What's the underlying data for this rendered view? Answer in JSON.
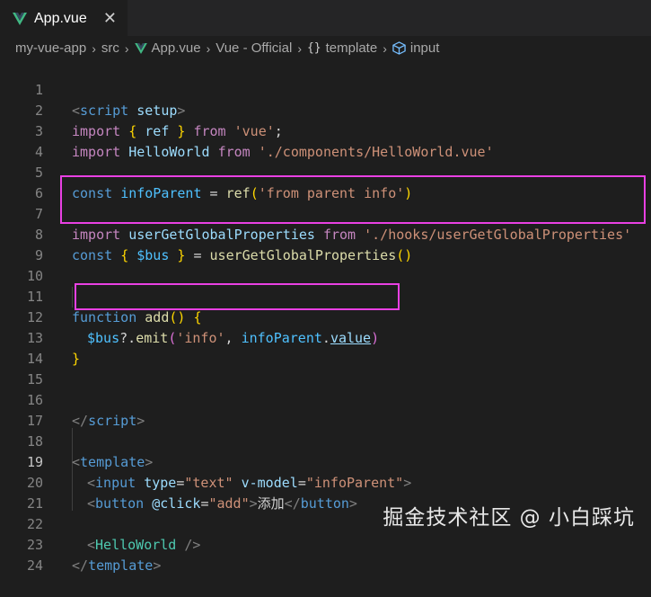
{
  "tab": {
    "title": "App.vue",
    "close": "✕"
  },
  "breadcrumb": {
    "items": [
      "my-vue-app",
      "src",
      "App.vue",
      "Vue - Official",
      "template",
      "input"
    ],
    "sep": "›"
  },
  "editor": {
    "active_line": 19,
    "line_numbers": [
      "1",
      "2",
      "3",
      "4",
      "5",
      "6",
      "7",
      "8",
      "9",
      "10",
      "11",
      "12",
      "13",
      "14",
      "15",
      "16",
      "17",
      "18",
      "19",
      "20",
      "21",
      "22",
      "23",
      "24"
    ],
    "lines": {
      "l1": [
        "<",
        "script",
        " ",
        "setup",
        ">"
      ],
      "l2": [
        "import",
        " ",
        "{",
        " ",
        "ref",
        " ",
        "}",
        " ",
        "from",
        " ",
        "'vue'",
        ";"
      ],
      "l3": [
        "import",
        " ",
        "HelloWorld",
        " ",
        "from",
        " ",
        "'./components/HelloWorld.vue'"
      ],
      "l5": [
        "const",
        " ",
        "infoParent",
        " = ",
        "ref",
        "(",
        "'from parent info'",
        ")"
      ],
      "l7": [
        "import",
        " ",
        "userGetGlobalProperties",
        " ",
        "from",
        " ",
        "'./hooks/userGetGlobalProperties'"
      ],
      "l8": [
        "const",
        " ",
        "{",
        " ",
        "$bus",
        " ",
        "}",
        " = ",
        "userGetGlobalProperties",
        "(",
        ")"
      ],
      "l11": [
        "function",
        " ",
        "add",
        "(",
        ")",
        " ",
        "{"
      ],
      "l12": [
        "$bus",
        "?.",
        "emit",
        "(",
        "'info'",
        ", ",
        "infoParent",
        ".",
        "value",
        ")"
      ],
      "l13": [
        "}"
      ],
      "l16": [
        "</",
        "script",
        ">"
      ],
      "l18": [
        "<",
        "template",
        ">"
      ],
      "l19": [
        "<",
        "input",
        " ",
        "type",
        "=",
        "\"text\"",
        " ",
        "v-model",
        "=",
        "\"infoParent\"",
        ">"
      ],
      "l20": [
        "<",
        "button",
        " ",
        "@click",
        "=",
        "\"add\"",
        ">",
        "添加",
        "</",
        "button",
        ">"
      ],
      "l22": [
        "<",
        "HelloWorld",
        " ",
        "/>"
      ],
      "l23": [
        "</",
        "template",
        ">"
      ]
    }
  },
  "watermark": "掘金技术社区 @ 小白踩坑",
  "colors": {
    "highlight_box": "#e940e3",
    "background": "#1e1e1e"
  }
}
